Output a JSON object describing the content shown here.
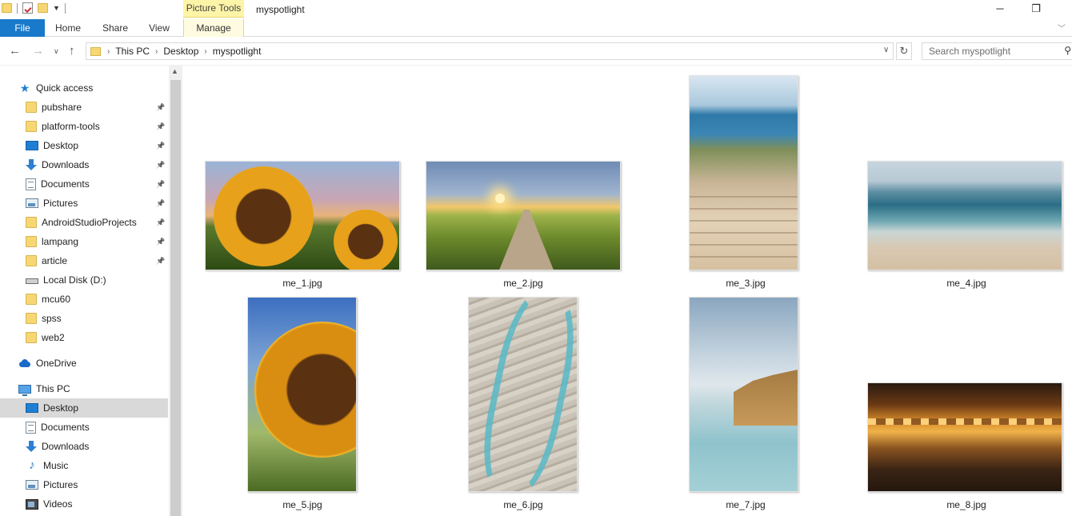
{
  "window": {
    "title": "myspotlight",
    "context_tab_group": "Picture Tools",
    "controls": {
      "minimize": "─",
      "restore": "❐"
    }
  },
  "ribbon": {
    "tabs": [
      {
        "label": "File"
      },
      {
        "label": "Home"
      },
      {
        "label": "Share"
      },
      {
        "label": "View"
      },
      {
        "label": "Manage"
      }
    ]
  },
  "address": {
    "breadcrumb": [
      "This PC",
      "Desktop",
      "myspotlight"
    ]
  },
  "search": {
    "placeholder": "Search myspotlight"
  },
  "nav": {
    "items": [
      {
        "label": "Quick access",
        "icon": "star-icon",
        "pinned": false
      },
      {
        "label": "pubshare",
        "icon": "folder-icon",
        "pinned": true
      },
      {
        "label": "platform-tools",
        "icon": "folder-icon",
        "pinned": true
      },
      {
        "label": "Desktop",
        "icon": "desktop-icon",
        "pinned": true
      },
      {
        "label": "Downloads",
        "icon": "downloads-icon",
        "pinned": true
      },
      {
        "label": "Documents",
        "icon": "documents-icon",
        "pinned": true
      },
      {
        "label": "Pictures",
        "icon": "pictures-icon",
        "pinned": true
      },
      {
        "label": "AndroidStudioProjects",
        "icon": "folder-icon",
        "pinned": true
      },
      {
        "label": "lampang",
        "icon": "folder-icon",
        "pinned": true
      },
      {
        "label": "article",
        "icon": "folder-icon",
        "pinned": true
      },
      {
        "label": "Local Disk (D:)",
        "icon": "disk-icon",
        "pinned": false
      },
      {
        "label": "mcu60",
        "icon": "folder-icon",
        "pinned": false
      },
      {
        "label": "spss",
        "icon": "folder-icon",
        "pinned": false
      },
      {
        "label": "web2",
        "icon": "folder-icon",
        "pinned": false
      },
      {
        "label": "OneDrive",
        "icon": "onedrive-icon",
        "pinned": false
      },
      {
        "label": "This PC",
        "icon": "this-pc-icon",
        "pinned": false
      },
      {
        "label": "Desktop",
        "icon": "desktop-icon",
        "pinned": false,
        "selected": true
      },
      {
        "label": "Documents",
        "icon": "documents-icon",
        "pinned": false
      },
      {
        "label": "Downloads",
        "icon": "downloads-icon",
        "pinned": false
      },
      {
        "label": "Music",
        "icon": "music-icon",
        "pinned": false
      },
      {
        "label": "Pictures",
        "icon": "pictures-icon",
        "pinned": false
      },
      {
        "label": "Videos",
        "icon": "videos-icon",
        "pinned": false
      }
    ]
  },
  "files": [
    {
      "name": "me_1.jpg"
    },
    {
      "name": "me_2.jpg"
    },
    {
      "name": "me_3.jpg"
    },
    {
      "name": "me_4.jpg"
    },
    {
      "name": "me_5.jpg"
    },
    {
      "name": "me_6.jpg"
    },
    {
      "name": "me_7.jpg"
    },
    {
      "name": "me_8.jpg"
    }
  ],
  "colors": {
    "file_tab": "#1979ca",
    "picture_tools": "#fdf4a8",
    "selected_nav": "#d9d9d9"
  }
}
